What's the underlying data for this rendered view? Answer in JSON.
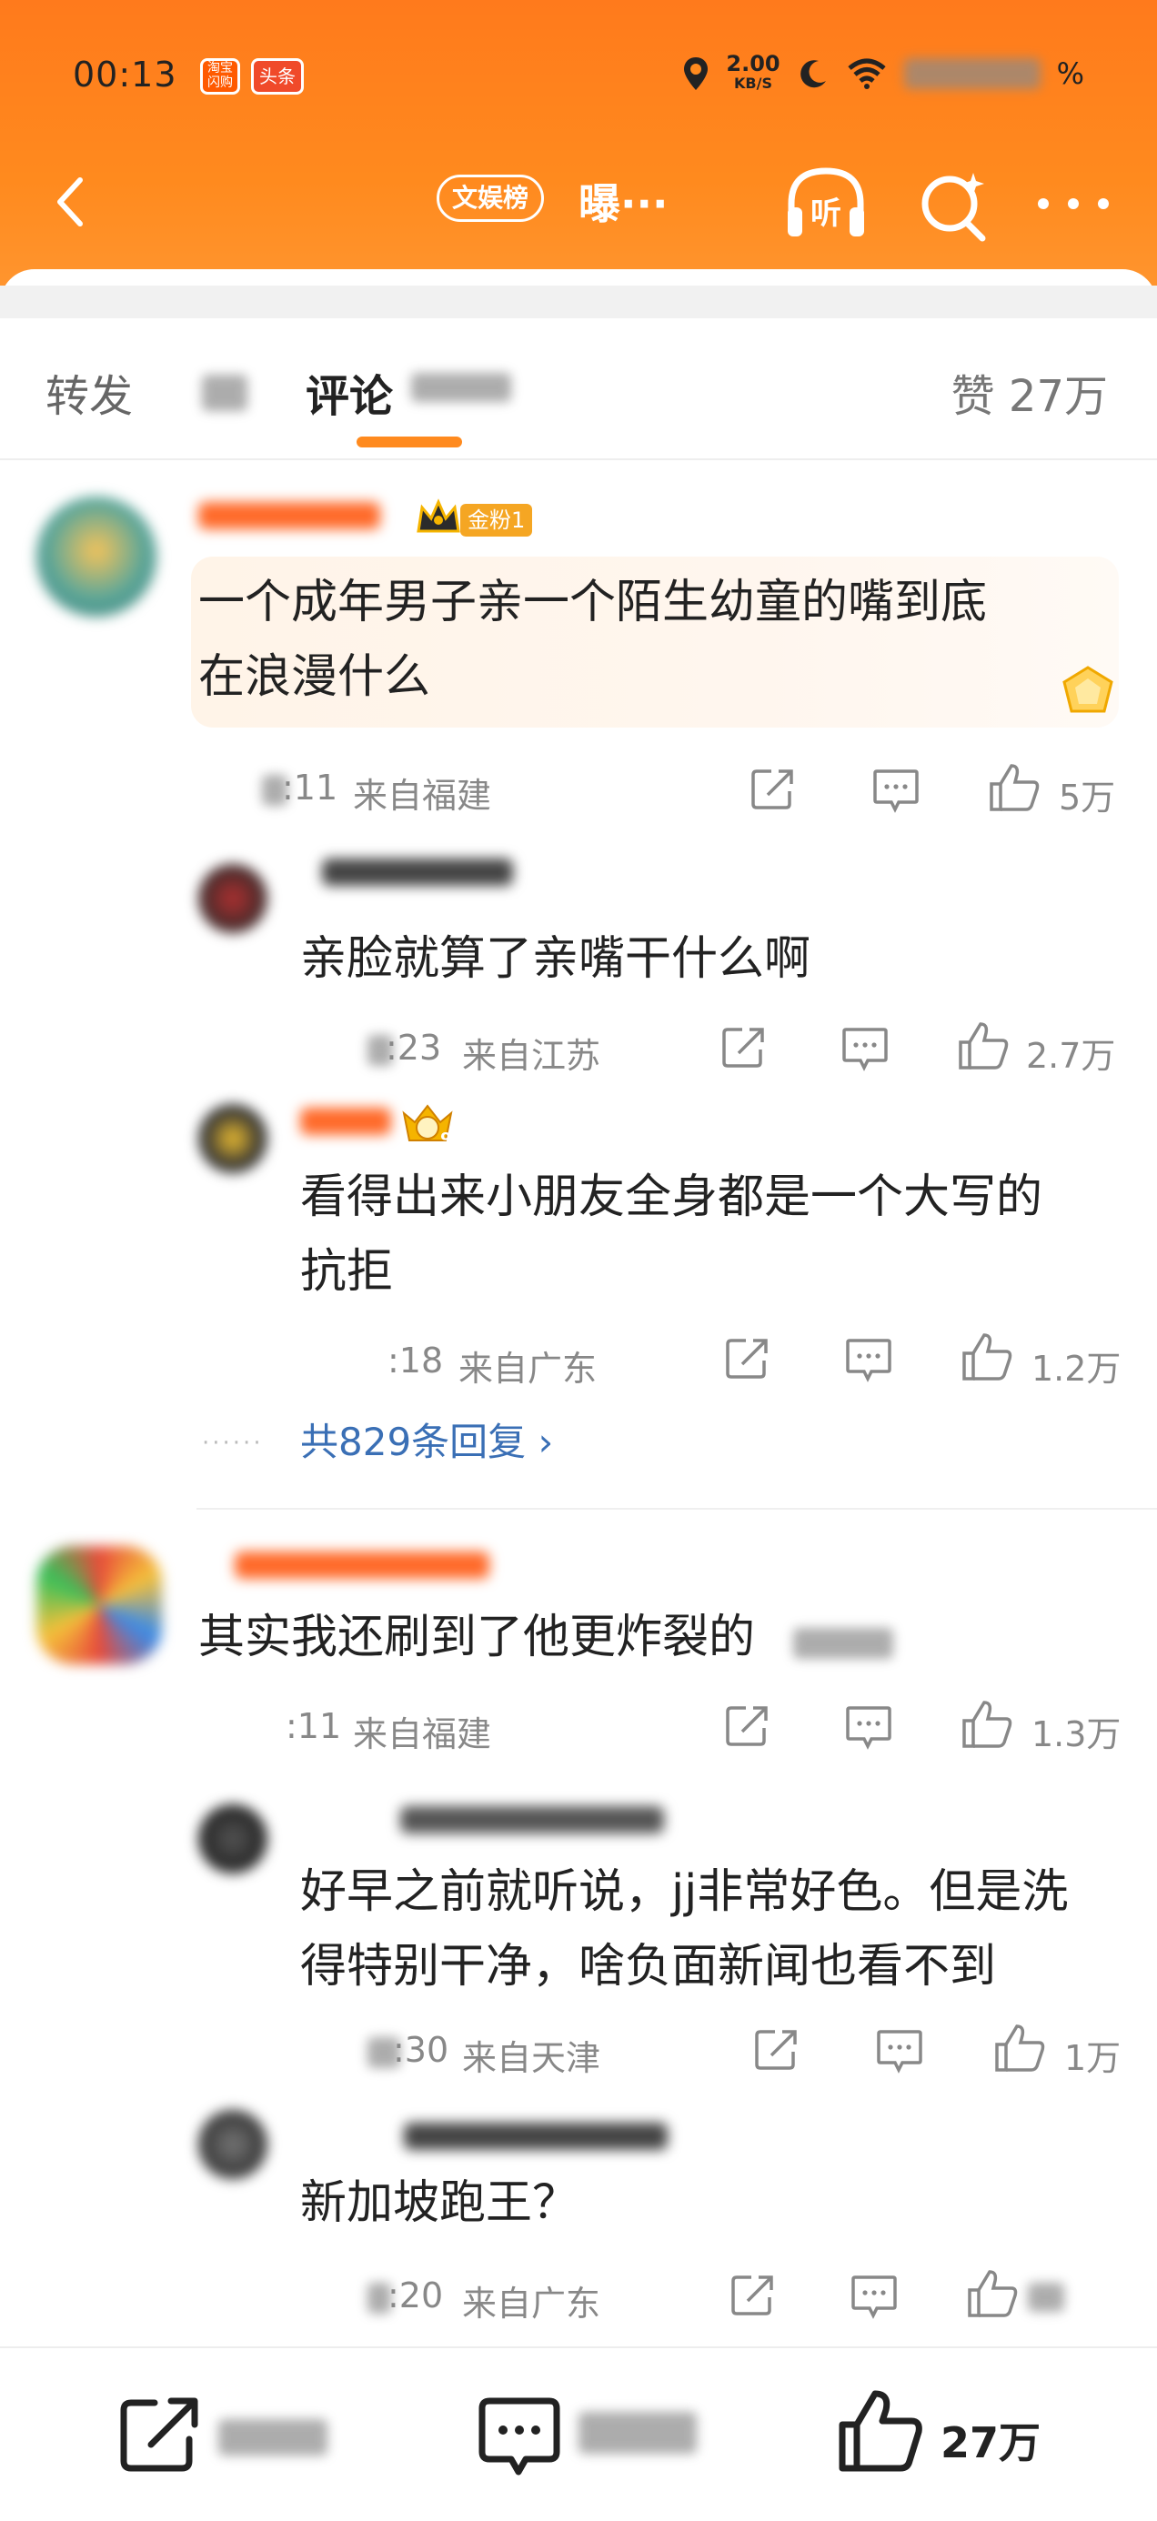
{
  "status_bar": {
    "time": "00:13",
    "app_icon_1": "淘宝闪购",
    "app_icon_2": "头条",
    "net_speed": "2.00",
    "net_unit": "KB/S",
    "battery_suffix": "%"
  },
  "nav": {
    "tag": "文娱榜",
    "title": "曝···"
  },
  "tabs": {
    "repost": "转发",
    "comment": "评论",
    "like": "赞 27万"
  },
  "comments": [
    {
      "fan_badge": "金粉1",
      "text_line1": "一个成年男子亲一个陌生幼童的嘴到底",
      "text_line2": "在浪漫什么",
      "time_suffix": ":11",
      "location": "来自福建",
      "likes": "5万"
    },
    {
      "text_line1": "亲脸就算了亲嘴干什么啊",
      "time_suffix": ":23",
      "location": "来自江苏",
      "likes": "2.7万"
    },
    {
      "badge_level": "9",
      "text_line1": "看得出来小朋友全身都是一个大写的",
      "text_line2": "抗拒",
      "time_suffix": ":18",
      "location": "来自广东",
      "likes": "1.2万"
    },
    {
      "text_line1": "其实我还刷到了他更炸裂的",
      "time_suffix": ":11",
      "location": "来自福建",
      "likes": "1.3万"
    },
    {
      "text_line1": "好早之前就听说，jj非常好色。但是洗",
      "text_line2": "得特别干净，啥负面新闻也看不到",
      "time_suffix": ":30",
      "location": "来自天津",
      "likes": "1万"
    },
    {
      "text_line1": "新加坡跑王？",
      "time_suffix": ":20",
      "location": "来自广东"
    }
  ],
  "more_replies": "共829条回复 ›",
  "more_dots": "······",
  "bottom_bar": {
    "like_count": "27万"
  },
  "colors": {
    "header": "#ff8a1e",
    "link": "#3a6fb5",
    "text": "#222222",
    "meta": "#888888"
  },
  "icons": [
    "back-icon",
    "headphone-icon",
    "search-icon",
    "more-icon",
    "share-icon",
    "comment-icon",
    "like-icon",
    "crown-icon"
  ]
}
